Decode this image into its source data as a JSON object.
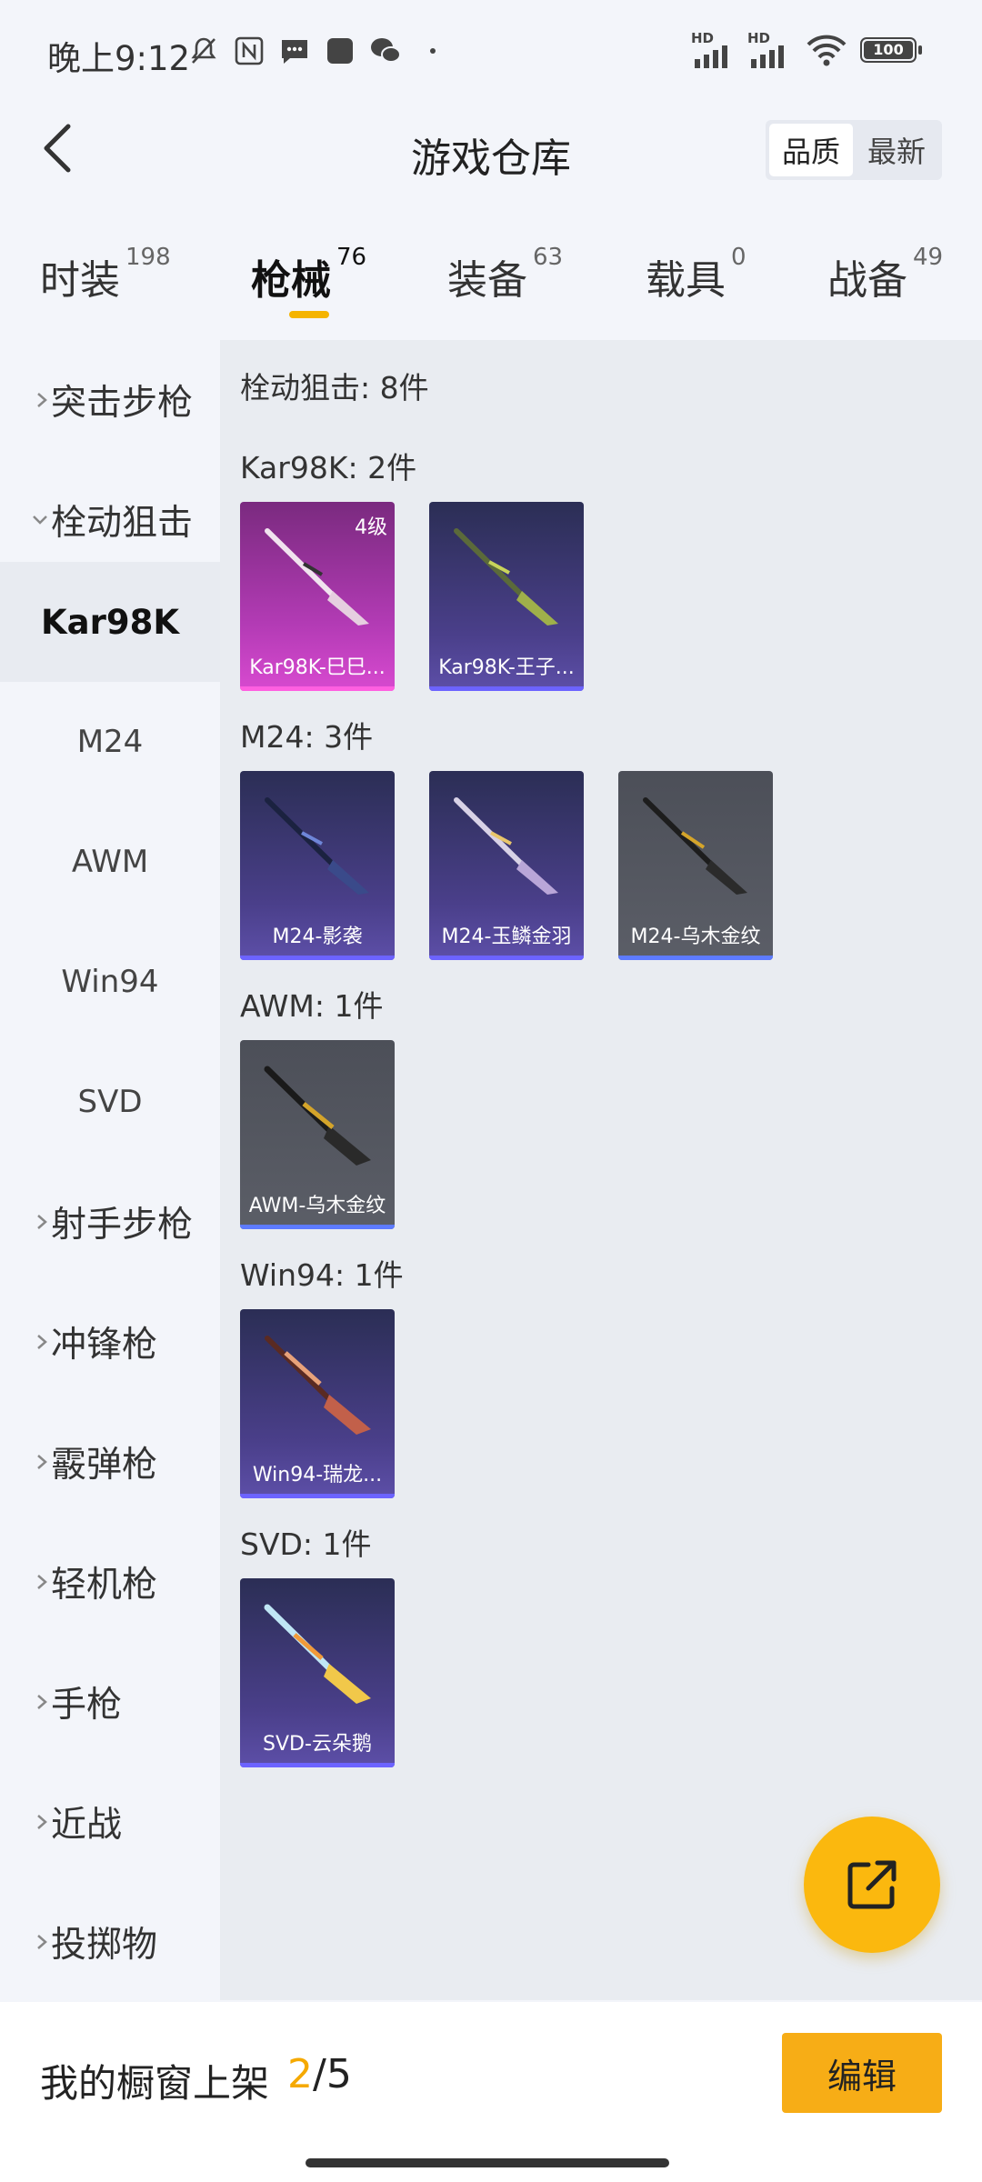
{
  "status_bar": {
    "time": "晚上9:12",
    "network1": "HD",
    "network2": "HD",
    "battery": "100"
  },
  "header": {
    "title": "游戏仓库",
    "sort_quality": "品质",
    "sort_newest": "最新"
  },
  "tabs": [
    {
      "label": "时装",
      "count": "198"
    },
    {
      "label": "枪械",
      "count": "76"
    },
    {
      "label": "装备",
      "count": "63"
    },
    {
      "label": "载具",
      "count": "0"
    },
    {
      "label": "战备",
      "count": "49"
    }
  ],
  "sidebar": {
    "categories": [
      {
        "label": "突击步枪"
      },
      {
        "label": "栓动狙击"
      },
      {
        "label": "射手步枪"
      },
      {
        "label": "冲锋枪"
      },
      {
        "label": "霰弹枪"
      },
      {
        "label": "轻机枪"
      },
      {
        "label": "手枪"
      },
      {
        "label": "近战"
      },
      {
        "label": "投掷物"
      }
    ],
    "subitems": [
      {
        "label": "Kar98K"
      },
      {
        "label": "M24"
      },
      {
        "label": "AWM"
      },
      {
        "label": "Win94"
      },
      {
        "label": "SVD"
      }
    ]
  },
  "content": {
    "section_title": "栓动狙击: 8件",
    "groups": [
      {
        "title": "Kar98K: 2件",
        "items": [
          {
            "name": "Kar98K-巳巳...",
            "level": "4级"
          },
          {
            "name": "Kar98K-王子..."
          }
        ]
      },
      {
        "title": "M24: 3件",
        "items": [
          {
            "name": "M24-影袭"
          },
          {
            "name": "M24-玉鳞金羽"
          },
          {
            "name": "M24-乌木金纹"
          }
        ]
      },
      {
        "title": "AWM: 1件",
        "items": [
          {
            "name": "AWM-乌木金纹"
          }
        ]
      },
      {
        "title": "Win94: 1件",
        "items": [
          {
            "name": "Win94-瑞龙..."
          }
        ]
      },
      {
        "title": "SVD: 1件",
        "items": [
          {
            "name": "SVD-云朵鹅"
          }
        ]
      }
    ]
  },
  "bottom": {
    "label": "我的橱窗上架",
    "current": "2",
    "total": "/5",
    "edit": "编辑"
  }
}
